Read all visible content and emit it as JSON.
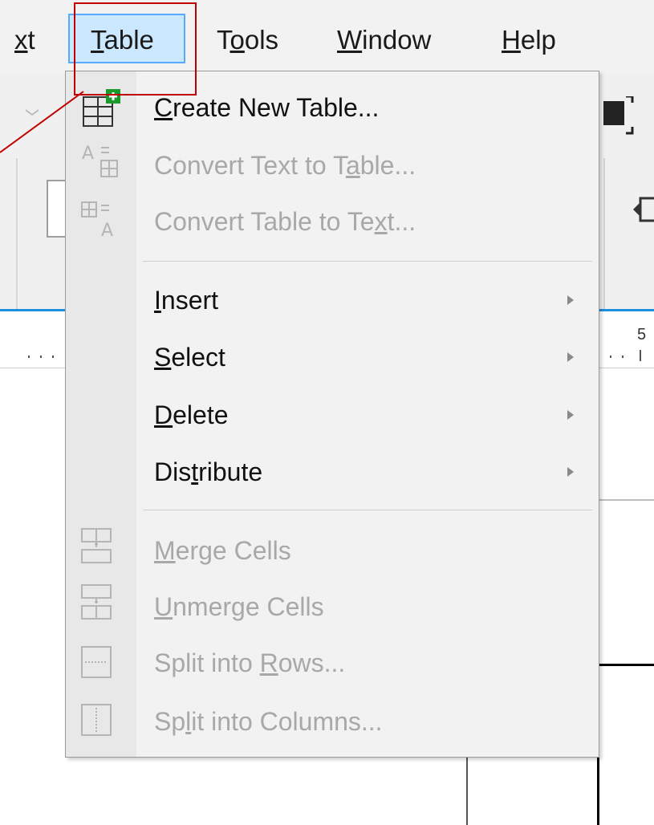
{
  "menubar": {
    "items": [
      {
        "label_pre": "",
        "label_ul": "x",
        "label_post": "t"
      },
      {
        "label_pre": "",
        "label_ul": "T",
        "label_post": "able"
      },
      {
        "label_pre": "T",
        "label_ul": "o",
        "label_post": "ols"
      },
      {
        "label_pre": "",
        "label_ul": "W",
        "label_post": "indow"
      },
      {
        "label_pre": "",
        "label_ul": "H",
        "label_post": "elp"
      }
    ]
  },
  "menu": {
    "items": [
      {
        "pre": "",
        "ul": "C",
        "post": "reate New Table...",
        "icon": "create-table-icon",
        "enabled": true
      },
      {
        "pre": "Convert Text to T",
        "ul": "a",
        "post": "ble...",
        "icon": "convert-text-to-table-icon",
        "enabled": false
      },
      {
        "pre": "Convert Table to Te",
        "ul": "x",
        "post": "t...",
        "icon": "convert-table-to-text-icon",
        "enabled": false
      },
      {
        "pre": "",
        "ul": "I",
        "post": "nsert",
        "submenu": true,
        "enabled": true
      },
      {
        "pre": "",
        "ul": "S",
        "post": "elect",
        "submenu": true,
        "enabled": true
      },
      {
        "pre": "",
        "ul": "D",
        "post": "elete",
        "submenu": true,
        "enabled": true
      },
      {
        "pre": "Dis",
        "ul": "t",
        "post": "ribute",
        "submenu": true,
        "enabled": true
      },
      {
        "pre": "",
        "ul": "M",
        "post": "erge Cells",
        "icon": "merge-cells-icon",
        "enabled": false
      },
      {
        "pre": "",
        "ul": "U",
        "post": "nmerge Cells",
        "icon": "unmerge-cells-icon",
        "enabled": false
      },
      {
        "pre": "Split into ",
        "ul": "R",
        "post": "ows...",
        "icon": "split-rows-icon",
        "enabled": false
      },
      {
        "pre": "Sp",
        "ul": "l",
        "post": "it into Columns...",
        "icon": "split-columns-icon",
        "enabled": false
      }
    ]
  },
  "ruler": {
    "tick_label": "5"
  },
  "colors": {
    "highlight": "#cce8ff",
    "annotation": "#c00000",
    "accent_line": "#1e90e0"
  }
}
